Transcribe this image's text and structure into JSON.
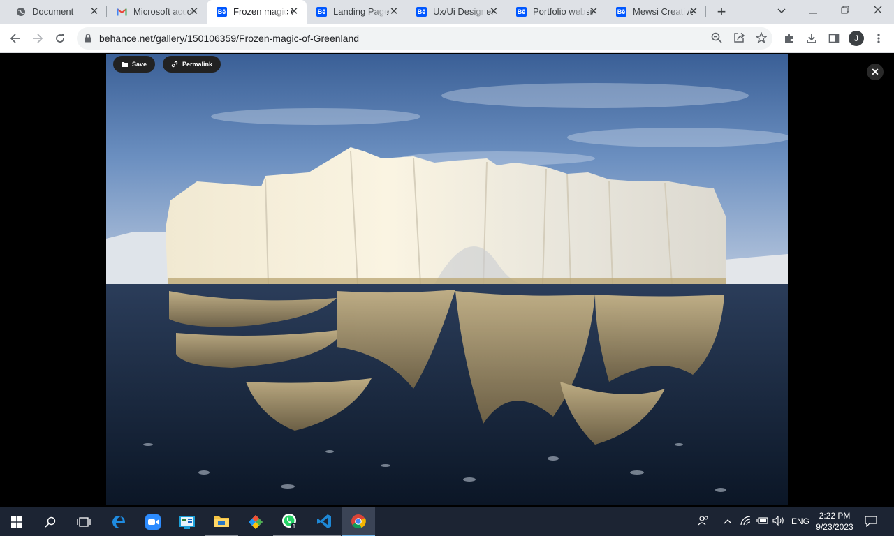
{
  "browser": {
    "tabs": [
      {
        "title": "Document",
        "favicon": "globe-icon",
        "active": false
      },
      {
        "title": "Microsoft account",
        "favicon": "gmail-icon",
        "active": false
      },
      {
        "title": "Frozen magic of Greenland",
        "favicon": "behance-icon",
        "active": true
      },
      {
        "title": "Landing Page - Behance",
        "favicon": "behance-icon",
        "active": false
      },
      {
        "title": "Ux/Ui Designer",
        "favicon": "behance-icon",
        "active": false
      },
      {
        "title": "Portfolio website",
        "favicon": "behance-icon",
        "active": false
      },
      {
        "title": "Mewsi Creative",
        "favicon": "behance-icon",
        "active": false
      }
    ],
    "behance_favicon_text": "Bē",
    "url": "behance.net/gallery/150106359/Frozen-magic-of-Greenland",
    "profile_initial": "J"
  },
  "viewer": {
    "save_label": "Save",
    "permalink_label": "Permalink"
  },
  "taskbar": {
    "language": "ENG",
    "time": "2:22 PM",
    "date": "9/23/2023",
    "badge_count": "1"
  },
  "colors": {
    "behance_blue": "#0057ff",
    "tabstrip_bg": "#dee1e6",
    "taskbar_bg": "#1c2433"
  }
}
